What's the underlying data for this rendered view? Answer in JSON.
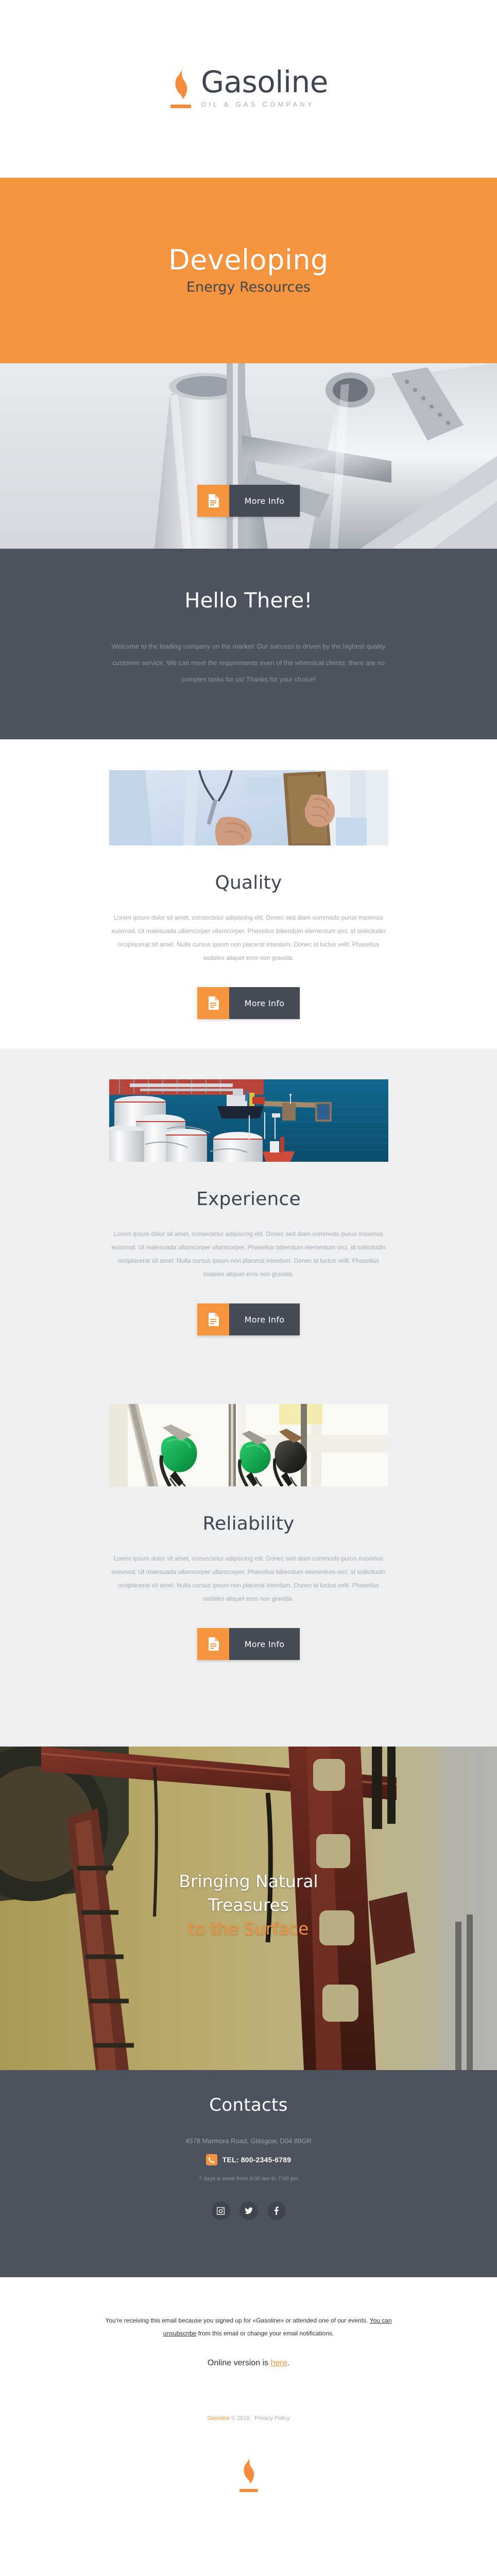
{
  "brand": {
    "name": "Gasoline",
    "tagline": "OIL & GAS COMPANY",
    "logo_icon": "flame-icon",
    "accent_color": "#f7943e",
    "dark_color": "#4d535e"
  },
  "hero": {
    "title": "Developing",
    "subtitle": "Energy Resources"
  },
  "pipe_banner": {
    "image_alt": "industrial-pipeline-photo",
    "button_label": "More Info",
    "button_icon": "document-icon"
  },
  "hello": {
    "title": "Hello There!",
    "body": "Welcome to the leading company on the market! Our success is driven by the highest quality customer service. We can meet the requirements even of the whimsical clients; there are no complex tasks for us! Thanks for your choice!"
  },
  "features": [
    {
      "id": "quality",
      "title": "Quality",
      "image_alt": "inspector-with-clipboard-photo",
      "body": "Lorem ipsum dolor sit amet, consectetur adipiscing elit. Donec sed diam commodo purus maximus euismod. Ut malesuada ullamcorper ullamcorper. Phasellus bibendum elementum orci, id sollicitudin orciplacerat sit amet. Nulla cursus ipsum non placerat interdum. Donec id luctus velit. Phasellus sodales aliquet eros non gravida.",
      "button_label": "More Info",
      "button_icon": "document-icon"
    },
    {
      "id": "experience",
      "title": "Experience",
      "image_alt": "oil-storage-tanks-harbor-photo",
      "body": "Lorem ipsum dolor sit amet, consectetur adipiscing elit. Donec sed diam commodo purus maximus euismod. Ut malesuada ullamcorper ullamcorper. Phasellus bibendum elementum orci, id sollicitudin orciplacerat sit amet. Nulla cursus ipsum non placerat interdum. Donec id luctus velit. Phasellus sodales aliquet eros non gravida.",
      "button_label": "More Info",
      "button_icon": "document-icon"
    },
    {
      "id": "reliability",
      "title": "Reliability",
      "image_alt": "fuel-pump-nozzles-photo",
      "body": "Lorem ipsum dolor sit amet, consectetur adipiscing elit. Donec sed diam commodo purus maximus euismod. Ut malesuada ullamcorper ullamcorper. Phasellus bibendum elementum orci, id sollicitudin orciplacerat sit amet. Nulla cursus ipsum non placerat interdum. Donec id luctus velit. Phasellus sodales aliquet eros non gravida.",
      "button_label": "More Info",
      "button_icon": "document-icon"
    }
  ],
  "pump_banner": {
    "image_alt": "oil-pump-jack-photo",
    "line1": "Bringing Natural",
    "line2": "Treasures",
    "line3": "to the Surface"
  },
  "contacts": {
    "title": "Contacts",
    "address": "4578 Marmora Road, Glasgow, D04 89GR",
    "phone": "TEL: 800-2345-6789",
    "phone_icon": "phone-icon",
    "hours": "7 days a week from 8:00 am to 7:00 pm",
    "social": [
      {
        "name": "instagram-icon",
        "label": "Instagram"
      },
      {
        "name": "twitter-icon",
        "label": "Twitter"
      },
      {
        "name": "facebook-icon",
        "label": "Facebook"
      }
    ]
  },
  "footer": {
    "legal_part1": "You're receiving this email because you signed up for «Gasoline» or attended one of our events. ",
    "legal_link": "You can unsubscribe",
    "legal_part2": " from this email or change your email notifications.",
    "online_prefix": "Online version is ",
    "online_link": "here",
    "online_suffix": ".",
    "copyright_brand": "Gasoline",
    "copyright_text": "© 2015.",
    "privacy_link": "Privacy Policy",
    "logo_icon": "flame-icon"
  }
}
